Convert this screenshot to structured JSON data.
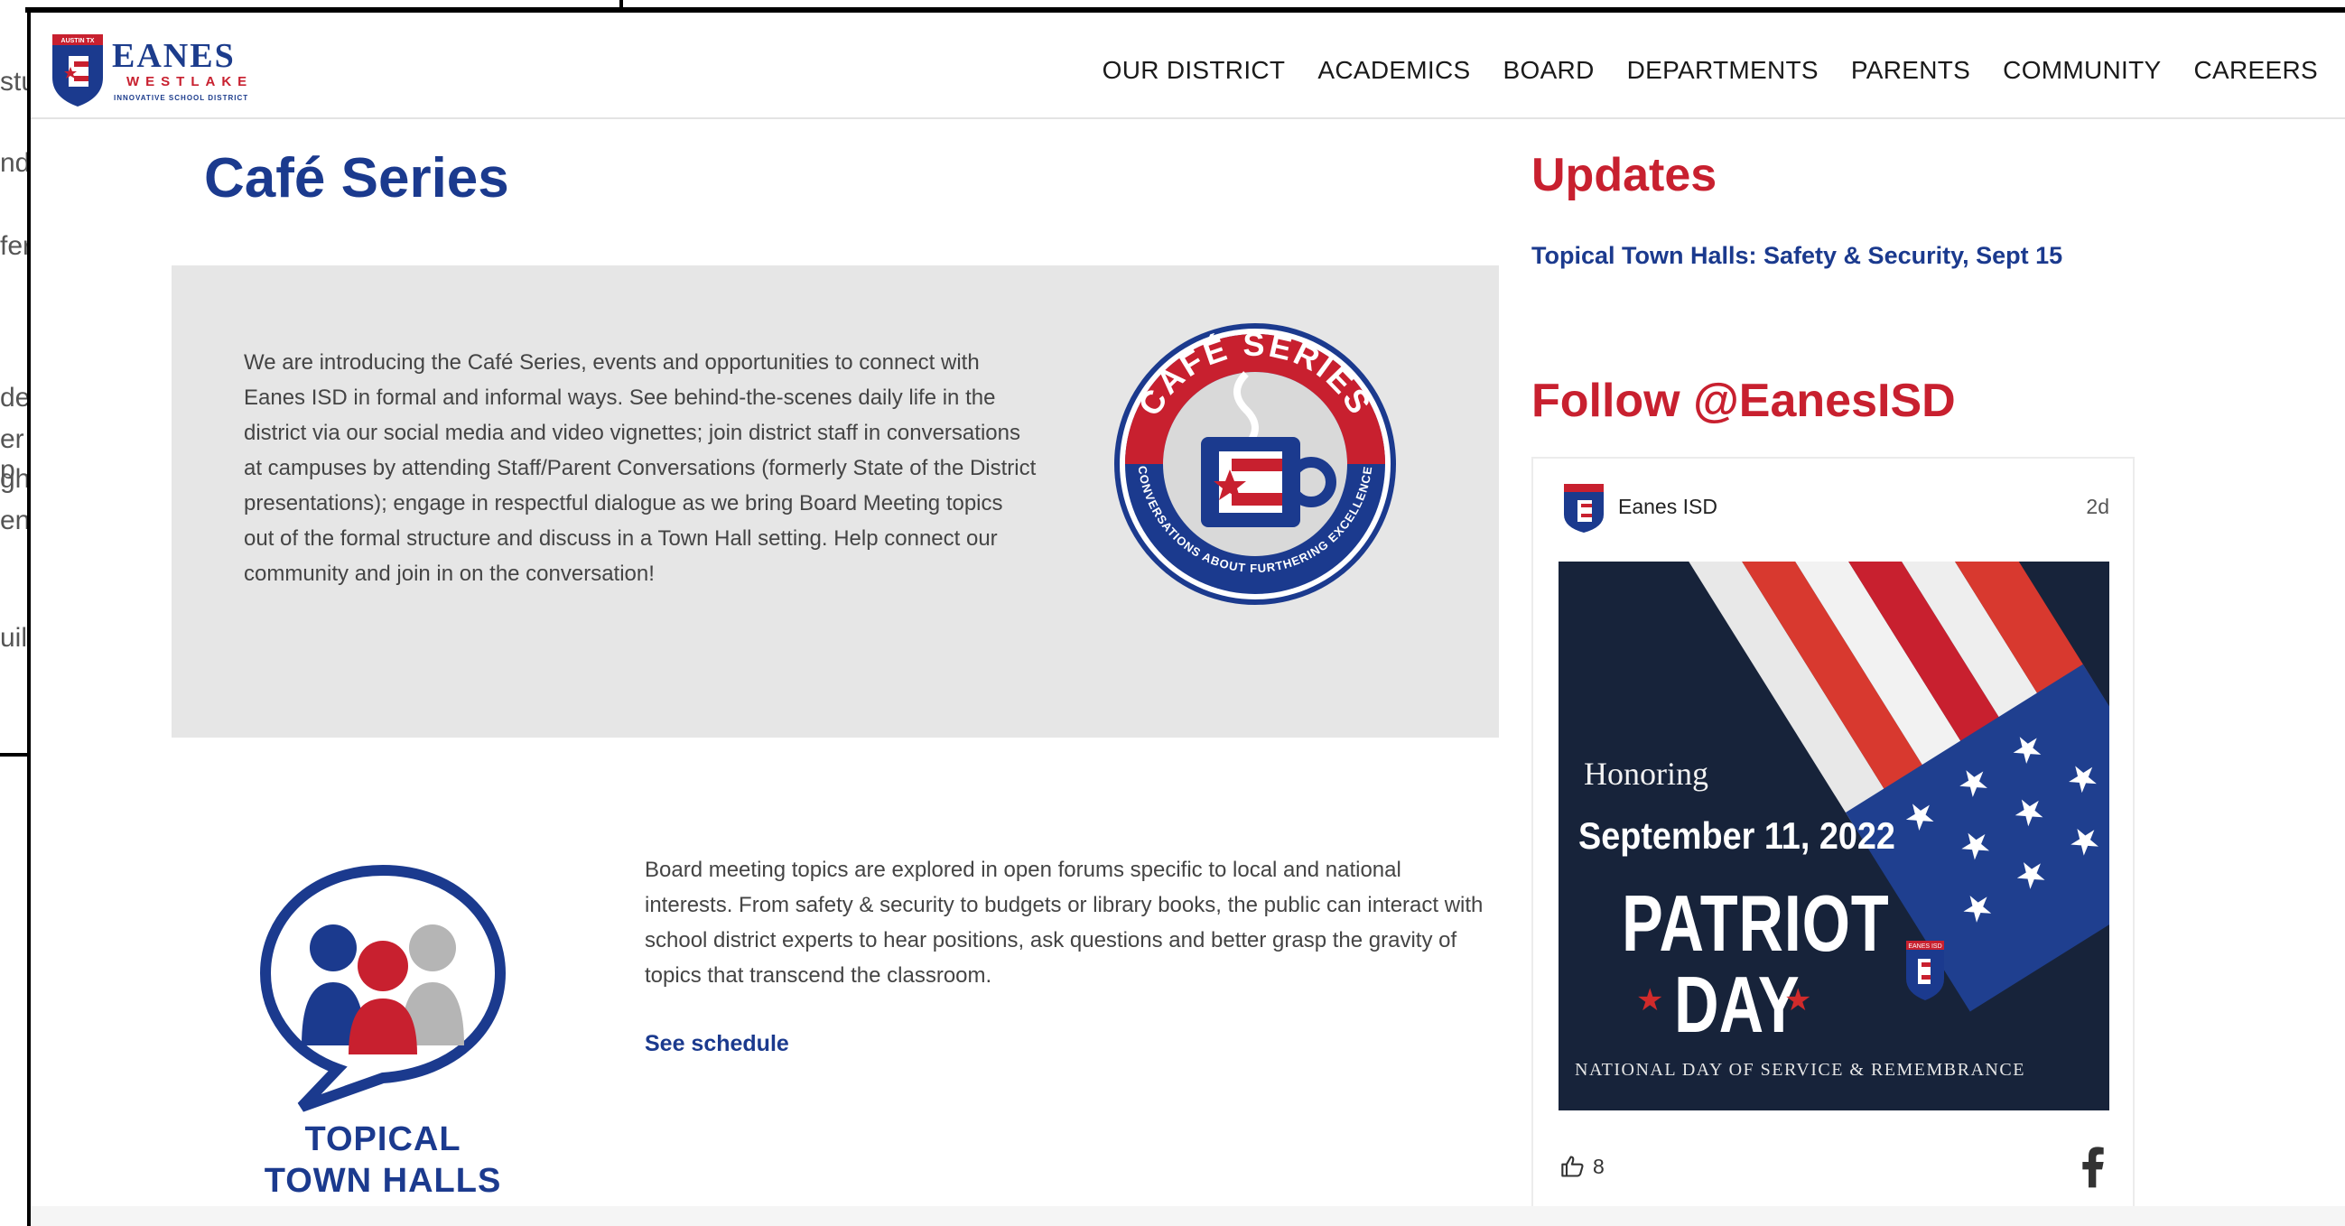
{
  "background_window": {
    "fragments": [
      "stu",
      "nd",
      "fer",
      "de",
      "er p",
      "gh",
      "en",
      "uil"
    ]
  },
  "header": {
    "logo": {
      "badge_text": "AUSTIN TX",
      "name": "EANES",
      "sub": "WESTLAKE",
      "tagline": "INNOVATIVE SCHOOL DISTRICT"
    },
    "nav": [
      "OUR DISTRICT",
      "ACADEMICS",
      "BOARD",
      "DEPARTMENTS",
      "PARENTS",
      "COMMUNITY",
      "CAREERS"
    ]
  },
  "main": {
    "title": "Café Series",
    "intro": "We are introducing the Café Series, events and opportunities to connect with Eanes ISD in formal and informal ways. See behind-the-scenes daily life in the district via our social media and video vignettes; join district staff in conversations at campuses by attending Staff/Parent Conversations (formerly State of the District presentations); engage in respectful dialogue as we bring Board Meeting topics out of the formal structure and discuss in a Town Hall setting. Help connect our community and join in on the conversation!",
    "cafe_badge": {
      "top_text": "CAFÉ SERIES",
      "ring_text": "CONVERSATIONS ABOUT FURTHERING EXCELLENCE"
    },
    "town_halls": {
      "logo_line1": "TOPICAL",
      "logo_line2": "TOWN HALLS",
      "text": "Board meeting topics are explored in open forums specific to local and national interests. From safety & security to budgets or library books, the public can interact with school district experts to hear positions, ask questions and better grasp the gravity of topics that transcend the classroom.",
      "link": "See schedule"
    }
  },
  "sidebar": {
    "updates_title": "Updates",
    "updates_link": "Topical Town Halls: Safety & Security, Sept 15",
    "follow_title": "Follow @EanesISD",
    "post": {
      "author": "Eanes ISD",
      "time": "2d",
      "image": {
        "honoring": "Honoring",
        "date": "September 11, 2022",
        "line1": "PATRIOT",
        "line2": "DAY",
        "badge": "EANES ISD",
        "footer": "NATIONAL DAY OF SERVICE & REMEMBRANCE"
      },
      "likes": "8"
    }
  },
  "colors": {
    "navy": "#1b3a8e",
    "red": "#c8202f",
    "gray_box": "#e6e6e6"
  },
  "icons": [
    "thumbs-up-icon",
    "facebook-icon"
  ]
}
